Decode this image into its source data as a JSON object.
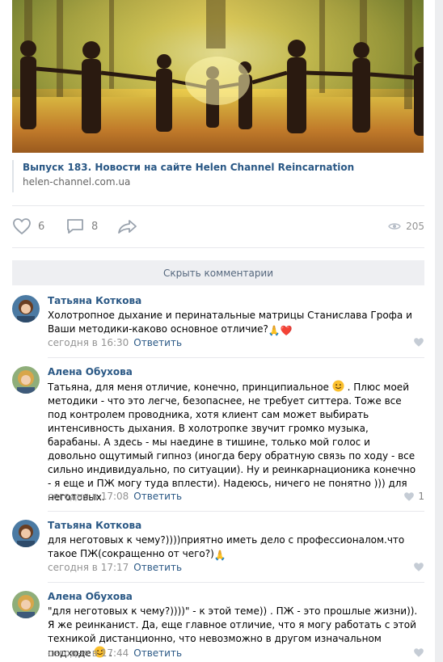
{
  "post": {
    "link_title": "Выпуск 183. Новости на сайте Helen Channel Reincarnation",
    "link_url": "helen-channel.com.ua"
  },
  "actions": {
    "likes": "6",
    "comments": "8",
    "views": "205"
  },
  "hide_comments_label": "Скрыть комментарии",
  "comments": [
    {
      "author": "Татьяна Коткова",
      "text": "Холотропное дыхание и перинатальные матрицы Станислава Грофа и Ваши методики-каково основное отличие?",
      "emoji": "🙏❤️",
      "time": "сегодня в 16:30",
      "reply": "Ответить",
      "likes": ""
    },
    {
      "author": "Алена Обухова",
      "text_a": "Татьяна, для меня отличие, конечно, принципиальное",
      "text_b": ". Плюс моей методики - что это легче, безопаснее, не требует ситтера. Тоже все под контролем проводника, хотя клиент сам может выбирать интенсивность дыхания. В холотропке звучит громко музыка, барабаны. А здесь - мы наедине в тишине, только мой голос и довольно ощутимый гипноз (иногда беру обратную связь по ходу - все сильно индивидуально, по ситуации). Ну и реинкарнационика конечно - я еще и ПЖ могу туда вплести). Надеюсь, ничего не понятно ))) для неготовых.",
      "time": "сегодня в 17:08",
      "reply": "Ответить",
      "likes": "1"
    },
    {
      "author": "Татьяна Коткова",
      "text": "для неготовых к чему?))))приятно иметь дело с профессионалом.что такое ПЖ(сокращенно от чего?)",
      "emoji": "🙏",
      "time": "сегодня в 17:17",
      "reply": "Ответить",
      "likes": ""
    },
    {
      "author": "Алена Обухова",
      "text_a": "\"для неготовых к чему?))))\" - к этой теме)) . ПЖ - это прошлые жизни)). Я же реинканист. Да, еще главное отличие, что я могу работать с этой техникой дистанционно, что невозможно в другом изначальном подходе",
      "text_b": ".",
      "time": "сегодня в 17:44",
      "reply": "Ответить",
      "likes": ""
    }
  ],
  "colors": {
    "link": "#2a5885",
    "muted": "#939393",
    "button_bg": "#eeeff2",
    "separator": "#e7e8ec"
  },
  "icons": [
    "heart-icon",
    "comment-icon",
    "share-icon",
    "eye-icon",
    "smile-emoji",
    "pray-emoji",
    "red-heart-emoji"
  ]
}
